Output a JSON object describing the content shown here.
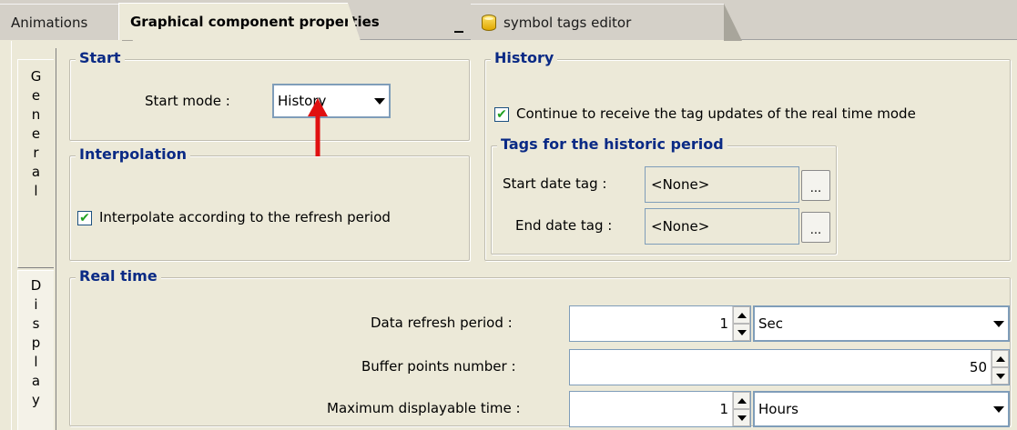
{
  "tabs": {
    "animations": "Animations",
    "graphical": "Graphical component properties",
    "close_glyph": "_",
    "symbol": "symbol tags editor"
  },
  "vtabs": {
    "general": [
      "G",
      "e",
      "n",
      "e",
      "r",
      "a",
      "l"
    ],
    "display": [
      "D",
      "i",
      "s",
      "p",
      "l",
      "a",
      "y"
    ]
  },
  "start": {
    "legend": "Start",
    "mode_label": "Start mode :",
    "mode_value": "History"
  },
  "interpolation": {
    "legend": "Interpolation",
    "checkbox_label": "Interpolate according to the refresh period",
    "checked": true
  },
  "history": {
    "legend": "History",
    "continue_label": "Continue to receive the tag updates of the real time mode",
    "continue_checked": true,
    "tags": {
      "legend": "Tags for the historic period",
      "start_label": "Start date tag :",
      "start_value": "<None>",
      "end_label": "End date tag :",
      "end_value": "<None>",
      "browse_label": "..."
    }
  },
  "realtime": {
    "legend": "Real time",
    "refresh_label": "Data refresh period :",
    "refresh_value": "1",
    "refresh_unit": "Sec",
    "buffer_label": "Buffer points number :",
    "buffer_value": "50",
    "maxtime_label": "Maximum displayable time :",
    "maxtime_value": "1",
    "maxtime_unit": "Hours"
  },
  "colors": {
    "legend_text": "#0a2a85",
    "annotation_arrow": "#e01010",
    "background": "#ece9d8"
  }
}
